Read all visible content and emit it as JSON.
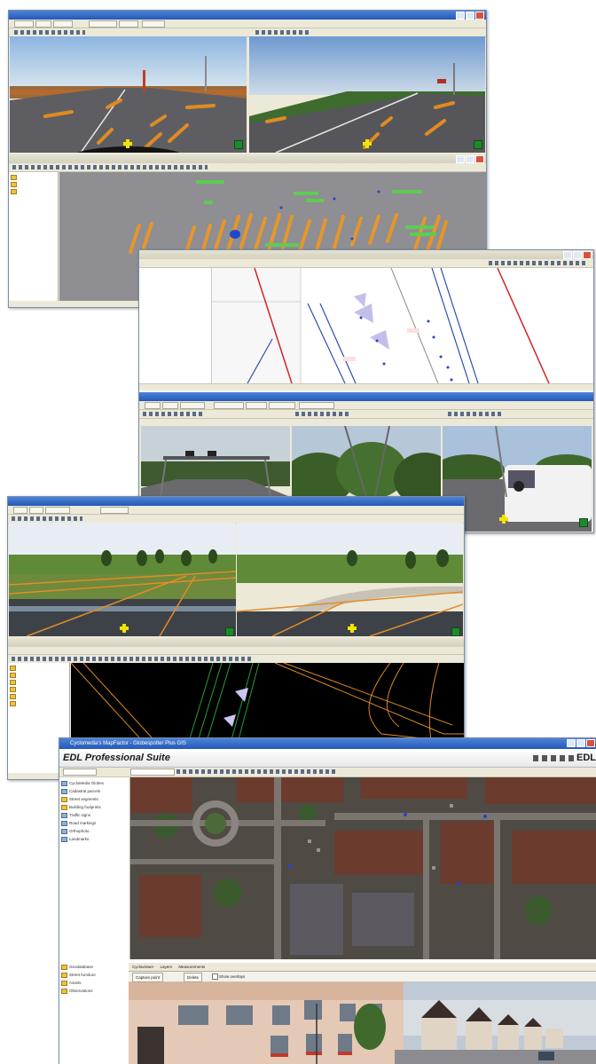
{
  "windows": {
    "w1": {
      "title": ""
    },
    "w2": {
      "title": ""
    },
    "w3": {
      "title": ""
    },
    "w4": {
      "title": ""
    },
    "w5": {
      "title": ""
    },
    "w6": {
      "title": ""
    }
  },
  "edl": {
    "window_title": "Cyclomedia's MapFactor - Globespotter Plus GIS",
    "brand": "EDL Professional Suite",
    "brand_short": "EDL",
    "layers": [
      "CycloMedia Globes",
      "Cadastral parcels",
      "Street segments",
      "Building footprints",
      "Traffic signs",
      "Road markings",
      "Orthophoto",
      "Landmarks"
    ],
    "lower_layers": [
      "Geodatabase",
      "Street furniture",
      "Assets",
      "Observations"
    ],
    "tabs": [
      "Cycloviewer",
      "Layers",
      "Measurements"
    ],
    "buttons": [
      "Capture point",
      "Delete"
    ],
    "checkbox_label": "Show overlays"
  },
  "accent": "#2458b5"
}
